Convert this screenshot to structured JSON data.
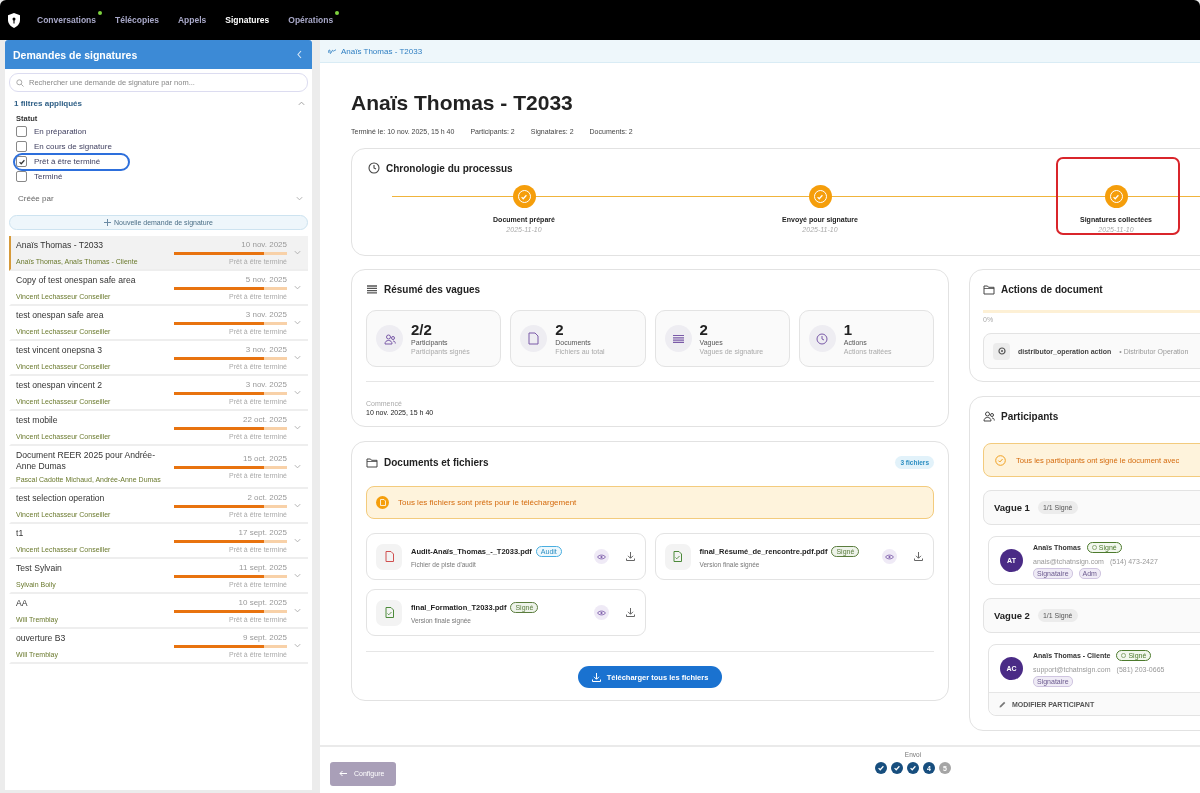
{
  "nav": {
    "items": [
      {
        "label": "Conversations",
        "selected": false,
        "badge": true
      },
      {
        "label": "Télécopies",
        "selected": false,
        "badge": false
      },
      {
        "label": "Appels",
        "selected": false,
        "badge": false
      },
      {
        "label": "Signatures",
        "selected": true,
        "badge": false
      },
      {
        "label": "Opérations",
        "selected": false,
        "badge": true
      }
    ]
  },
  "sidebar": {
    "title": "Demandes de signatures",
    "search": {
      "placeholder": "Rechercher une demande de signature par nom..."
    },
    "filters": {
      "summary": "1 filtres appliqués",
      "expanded": true,
      "status_label": "Statut",
      "options": [
        {
          "label": "En préparation",
          "checked": false,
          "highlighted": false
        },
        {
          "label": "En cours de signature",
          "checked": false,
          "highlighted": false
        },
        {
          "label": "Prêt à être terminé",
          "checked": true,
          "highlighted": true
        },
        {
          "label": "Terminé",
          "checked": false,
          "highlighted": false
        }
      ],
      "created_by": "Créée par"
    },
    "new_button": "Nouvelle demande de signature",
    "items": [
      {
        "title": "Anaïs Thomas - T2033",
        "date": "10 nov. 2025",
        "authors": "Anaïs Thomas, Anaïs Thomas - Cliente",
        "status": "Prêt à être terminé",
        "level": 0.8,
        "selected": true
      },
      {
        "title": "Copy of test onespan safe area",
        "date": "5 nov. 2025",
        "authors": "Vincent Lechasseur Conseiller",
        "status": "Prêt à être terminé",
        "level": 0.8,
        "selected": false
      },
      {
        "title": "test onespan safe area",
        "date": "3 nov. 2025",
        "authors": "Vincent Lechasseur Conseiller",
        "status": "Prêt à être terminé",
        "level": 0.8,
        "selected": false
      },
      {
        "title": "test vincent onepsna 3",
        "date": "3 nov. 2025",
        "authors": "Vincent Lechasseur Conseiller",
        "status": "Prêt à être terminé",
        "level": 0.8,
        "selected": false
      },
      {
        "title": "test onespan vincent 2",
        "date": "3 nov. 2025",
        "authors": "Vincent Lechasseur Conseiller",
        "status": "Prêt à être terminé",
        "level": 0.8,
        "selected": false
      },
      {
        "title": "test mobile",
        "date": "22 oct. 2025",
        "authors": "Vincent Lechasseur Conseiller",
        "status": "Prêt à être terminé",
        "level": 0.8,
        "selected": false
      },
      {
        "title": "Document REER 2025 pour Andrée-Anne Dumas",
        "date": "15 oct. 2025",
        "authors": "Pascal Cadotte Michaud, Andrée-Anne Dumas",
        "status": "Prêt à être terminé",
        "level": 0.8,
        "selected": false
      },
      {
        "title": "test selection operation",
        "date": "2 oct. 2025",
        "authors": "Vincent Lechasseur Conseiller",
        "status": "Prêt à être terminé",
        "level": 0.8,
        "selected": false
      },
      {
        "title": "t1",
        "date": "17 sept. 2025",
        "authors": "Vincent Lechasseur Conseiller",
        "status": "Prêt à être terminé",
        "level": 0.8,
        "selected": false
      },
      {
        "title": "Test Sylvain",
        "date": "11 sept. 2025",
        "authors": "Sylvain Boily",
        "status": "Prêt à être terminé",
        "level": 0.8,
        "selected": false
      },
      {
        "title": "AA",
        "date": "10 sept. 2025",
        "authors": "Will Tremblay",
        "status": "Prêt à être terminé",
        "level": 0.8,
        "selected": false
      },
      {
        "title": "ouverture B3",
        "date": "9 sept. 2025",
        "authors": "Will Tremblay",
        "status": "Prêt à être terminé",
        "level": 0.8,
        "selected": false
      }
    ]
  },
  "breadcrumb": "Anaïs Thomas - T2033",
  "header": {
    "title": "Anaïs Thomas - T2033",
    "meta": [
      "Terminé le: 10 nov. 2025, 15 h 40",
      "Participants: 2",
      "Signataires: 2",
      "Documents: 2"
    ]
  },
  "timeline": {
    "title": "Chronologie du processus",
    "steps": [
      {
        "label": "Document préparé",
        "date": "2025-11-10",
        "done": true,
        "highlighted": false
      },
      {
        "label": "Envoyé pour signature",
        "date": "2025-11-10",
        "done": true,
        "highlighted": false
      },
      {
        "label": "Signatures collectées",
        "date": "2025-11-10",
        "done": true,
        "highlighted": true
      }
    ]
  },
  "summary": {
    "title": "Résumé des vagues",
    "stats": [
      {
        "kind": "participants",
        "value": "2/2",
        "label": "Participants",
        "sub": "Participants signés"
      },
      {
        "kind": "documents",
        "value": "2",
        "label": "Documents",
        "sub": "Fichiers au total"
      },
      {
        "kind": "waves",
        "value": "2",
        "label": "Vagues",
        "sub": "Vagues de signature"
      },
      {
        "kind": "actions",
        "value": "1",
        "label": "Actions",
        "sub": "Actions traitées"
      }
    ],
    "started_label": "Commencé",
    "started": "10 nov. 2025, 15 h 40"
  },
  "documents": {
    "title": "Documents et fichiers",
    "count": "3 fichiers",
    "notice": "Tous les fichiers sont prêts pour le téléchargement",
    "files": [
      {
        "kind": "audit",
        "name": "Audit-Anaïs_Thomas_-_T2033.pdf",
        "tag": "Audit",
        "desc": "Fichier de piste d'audit"
      },
      {
        "kind": "signed",
        "name": "final_Résumé_de_rencontre.pdf.pdf",
        "tag": "Signé",
        "desc": "Version finale signée"
      },
      {
        "kind": "signed",
        "name": "final_Formation_T2033.pdf",
        "tag": "Signé",
        "desc": "Version finale signée"
      }
    ],
    "download_all": "Télécharger tous les fichiers"
  },
  "actions": {
    "title": "Actions de document",
    "level": 0,
    "percent": "0%",
    "items": [
      {
        "name": "distributor_operation action",
        "type": "• Distributor Operation"
      }
    ]
  },
  "participants": {
    "title": "Participants",
    "notice": "Tous les participants ont signé le document avec",
    "waves": [
      {
        "title": "Vague 1",
        "badge": "1/1 Signé",
        "people": [
          {
            "initials": "AT",
            "name": "Anaïs Thomas",
            "status": "Signé",
            "email": "anais@tchatnsign.com",
            "phone": "(514) 473-2427",
            "roles": [
              "Signataire",
              "Adm"
            ]
          }
        ]
      },
      {
        "title": "Vague 2",
        "badge": "1/1 Signé",
        "people": [
          {
            "initials": "AC",
            "name": "Anaïs Thomas - Cliente",
            "status": "Signé",
            "email": "support@tchatnsign.com",
            "phone": "(581) 203-0665",
            "roles": [
              "Signataire"
            ],
            "edit": "MODIFIER PARTICIPANT"
          }
        ]
      }
    ]
  },
  "footer": {
    "back": "Configure",
    "back_disabled": true,
    "step_label": "Envoi",
    "steps": [
      {
        "kind": "done"
      },
      {
        "kind": "done"
      },
      {
        "kind": "done"
      },
      {
        "kind": "current",
        "number": "4"
      },
      {
        "kind": "upcoming",
        "number": "5"
      }
    ]
  }
}
